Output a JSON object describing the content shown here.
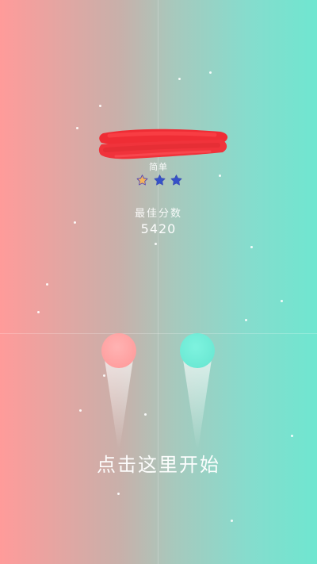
{
  "difficulty": {
    "label": "简单",
    "stars_filled": 1,
    "stars_total": 3,
    "colors": {
      "filled": "#f4b45d",
      "empty": "#3552c9"
    }
  },
  "best": {
    "label": "最佳分数",
    "score": "5420"
  },
  "start_prompt": "点击这里开始",
  "colors": {
    "background_left": "#ff9b9a",
    "background_right": "#6fe6d0",
    "left_ball": "#ff9f9f",
    "right_ball": "#6ce9d4",
    "title_redaction": "#f0333b"
  },
  "icons": {
    "star_filled": "star-icon",
    "star_empty": "star-icon"
  }
}
